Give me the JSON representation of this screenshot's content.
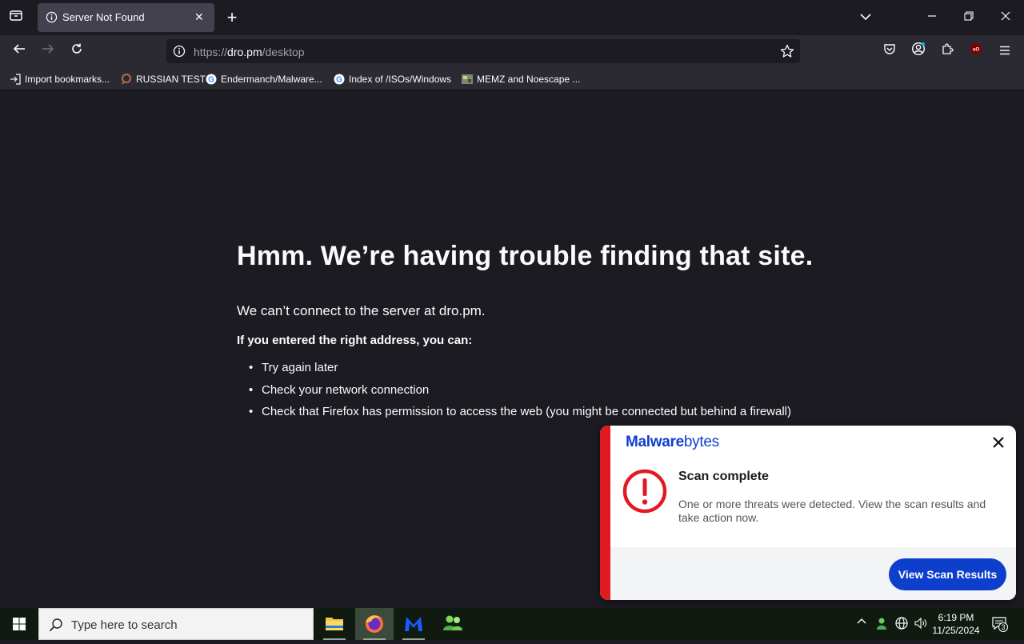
{
  "browser": {
    "tab_title": "Server Not Found",
    "url": {
      "scheme": "https://",
      "host": "dro.pm",
      "path": "/desktop"
    },
    "bookmarks": [
      {
        "label": "Import bookmarks...",
        "icon": "import-icon"
      },
      {
        "label": "RUSSIAN TEST",
        "icon": "magnifier-favicon"
      },
      {
        "label": "Endermanch/Malware...",
        "icon": "google-favicon"
      },
      {
        "label": "Index of /ISOs/Windows",
        "icon": "google-favicon"
      },
      {
        "label": "MEMZ and Noescape ...",
        "icon": "image-favicon"
      }
    ]
  },
  "error_page": {
    "title": "Hmm. We’re having trouble finding that site.",
    "description": "We can’t connect to the server at dro.pm.",
    "lead": "If you entered the right address, you can:",
    "suggestions": [
      "Try again later",
      "Check your network connection",
      "Check that Firefox has permission to access the web (you might be connected but behind a firewall)"
    ]
  },
  "toast": {
    "brand_bold": "Malware",
    "brand_light": "bytes",
    "heading": "Scan complete",
    "message": "One or more threats were detected. View the scan results and take action now.",
    "button_label": "View Scan Results",
    "accent_color": "#e11a22",
    "brand_color": "#0d3ecc"
  },
  "taskbar": {
    "search_placeholder": "Type here to search",
    "apps": [
      "file-explorer-icon",
      "firefox-icon",
      "malwarebytes-icon",
      "people-icon"
    ],
    "time": "6:19 PM",
    "date": "11/25/2024",
    "notification_count": "3"
  }
}
